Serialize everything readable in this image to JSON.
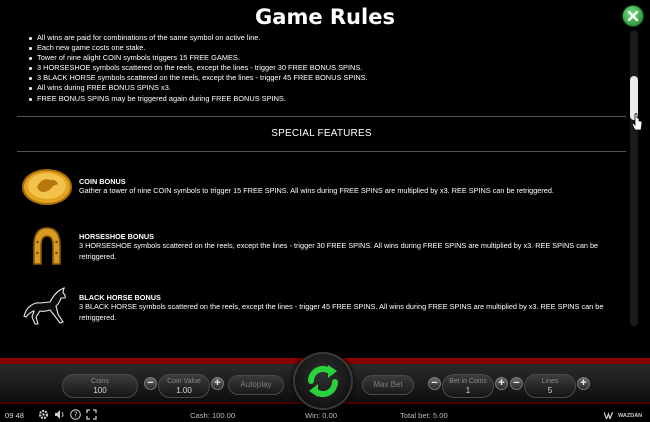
{
  "header": {
    "title": "Game Rules"
  },
  "rules": [
    "All wins are paid for combinations of the same symbol on active line.",
    "Each new game costs one stake.",
    "Tower of nine alight COIN symbols triggers 15 FREE GAMES.",
    "3 HORSESHOE symbols scattered on the reels, except the lines - trigger 30 FREE BONUS SPINS.",
    "3 BLACK HORSE symbols scattered on the reels, except the lines - trigger 45 FREE BONUS SPINS.",
    "All wins during FREE BONUS SPINS x3.",
    "FREE BONUS SPINS may be triggered again during FREE BONUS SPINS."
  ],
  "special_features": {
    "title": "SPECIAL FEATURES",
    "items": [
      {
        "name": "COIN BONUS",
        "icon": "coin-icon",
        "description": "Gather a tower of nine COIN symbols to trigger 15 FREE SPINS. All wins during FREE SPINS are multiplied by x3. REE SPINS can be retriggered."
      },
      {
        "name": "HORSESHOE BONUS",
        "icon": "horseshoe-icon",
        "description": "3 HORSESHOE symbols scattered on the reels, except the lines - trigger 30 FREE SPINS. All wins during FREE SPINS are multiplied by x3. REE SPINS can be retriggered."
      },
      {
        "name": "BLACK HORSE BONUS",
        "icon": "black-horse-icon",
        "description": "3 BLACK HORSE symbols scattered on the reels, except the lines - trigger 45 FREE SPINS. All wins during FREE SPINS are multiplied by x3. REE SPINS can be retriggered."
      }
    ]
  },
  "controls": {
    "coins": {
      "label": "Coins",
      "value": "100"
    },
    "coin_value": {
      "label": "Coin Value",
      "value": "1.00"
    },
    "autoplay_label": "Autoplay",
    "max_bet_label": "Max Bet",
    "bet_in_coins": {
      "label": "Bet in Coins",
      "value": "1"
    },
    "lines": {
      "label": "Lines",
      "value": "5"
    },
    "minus": "−",
    "plus": "+"
  },
  "status_bar": {
    "time": "09 48",
    "cash": "Cash: 100.00",
    "win": "Win: 0.00",
    "total_bet": "Total bet: 5.00",
    "brand": "WAZDAN"
  },
  "colors": {
    "accent_green": "#2fbf3a",
    "panel_red": "#8a0000",
    "gold": "#e3a21f"
  }
}
